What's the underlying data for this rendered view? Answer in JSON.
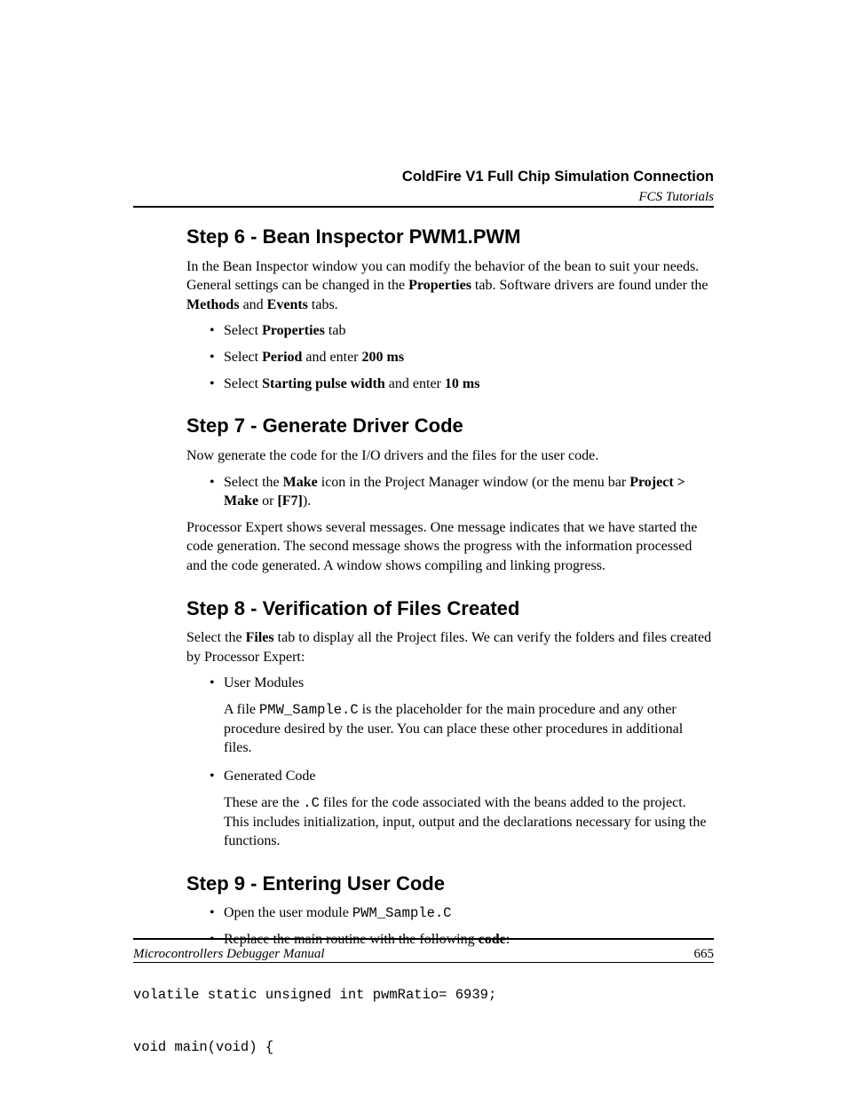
{
  "header": {
    "chapter": "ColdFire V1 Full Chip Simulation Connection",
    "section": "FCS Tutorials"
  },
  "footer": {
    "manual": "Microcontrollers Debugger Manual",
    "page": "665"
  },
  "step6": {
    "heading": "Step 6 - Bean Inspector PWM1.PWM",
    "intro_pre": "In the Bean Inspector window you can modify the behavior of the bean to suit your needs. General settings can be changed in the ",
    "properties_word": "Properties",
    "intro_mid": " tab. Software drivers are found under the ",
    "methods_word": "Methods",
    "and1": " and ",
    "events_word": "Events",
    "intro_post": " tabs.",
    "b1_pre": "Select ",
    "b1_bold": "Properties",
    "b1_post": " tab",
    "b2_pre": "Select ",
    "b2_bold1": "Period",
    "b2_mid": " and enter ",
    "b2_bold2": "200 ms",
    "b3_pre": "Select ",
    "b3_bold1": "Starting pulse width",
    "b3_mid": " and enter ",
    "b3_bold2": "10 ms"
  },
  "step7": {
    "heading": "Step 7 - Generate Driver Code",
    "intro": "Now generate the code for the I/O drivers and the files for the user code.",
    "b1_pre": "Select the ",
    "b1_bold1": "Make",
    "b1_mid1": " icon in the Project Manager window (or the menu bar ",
    "b1_bold2": "Project > Make",
    "b1_mid2": " or ",
    "b1_bold3": "[F7]",
    "b1_post": ").",
    "para2": "Processor Expert shows several messages. One message indicates that we have started the code generation. The second message shows the progress with the information processed and the code generated. A window shows compiling and linking progress."
  },
  "step8": {
    "heading": "Step 8 - Verification of Files Created",
    "intro_pre": "Select the ",
    "intro_bold": "Files",
    "intro_post": " tab to display all the Project files. We can verify the folders and files created by Processor Expert:",
    "b1": "User Modules",
    "b1_desc_pre": "A file ",
    "b1_desc_code": "PMW_Sample.C",
    "b1_desc_post": " is the placeholder for the main procedure and any other procedure desired by the user. You can place these other procedures in additional files.",
    "b2": "Generated Code",
    "b2_desc_pre": "These are the ",
    "b2_desc_code": ".C",
    "b2_desc_post": " files for the code associated with the beans added to the project. This includes initialization, input, output and the declarations necessary for using the functions."
  },
  "step9": {
    "heading": "Step 9 - Entering User Code",
    "b1_pre": "Open the user module ",
    "b1_code": "PWM_Sample.C",
    "b2_pre": "Replace the main routine with the following ",
    "b2_bold": "code",
    "b2_post": ":"
  },
  "code": {
    "line1": "volatile static unsigned int pwmRatio= 6939;",
    "line2": "void main(void) {"
  }
}
